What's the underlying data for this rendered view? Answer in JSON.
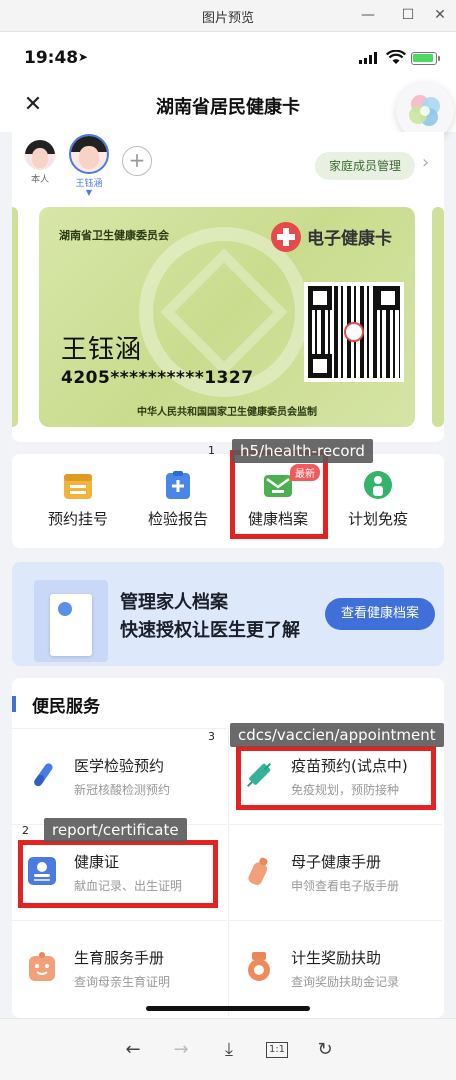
{
  "window": {
    "title": "图片预览",
    "min_label": "—",
    "max_label": "☐",
    "close_label": "✕"
  },
  "status": {
    "time": "19:48"
  },
  "nav": {
    "title": "湖南省居民健康卡"
  },
  "members": [
    {
      "name": "本人"
    },
    {
      "name": "王钰涵"
    }
  ],
  "add_member": "+",
  "family_button": "家庭成员管理",
  "card": {
    "org": "湖南省卫生健康委员会",
    "title": "电子健康卡",
    "holder": "王钰涵",
    "id_number": "4205**********1327",
    "supervisor": "中华人民共和国国家卫生健康委员会监制"
  },
  "quick_actions": [
    {
      "label": "预约挂号",
      "icon": "calendar-icon",
      "color": "#f3b23a"
    },
    {
      "label": "检验报告",
      "icon": "clipboard-plus-icon",
      "color": "#4a86e8"
    },
    {
      "label": "健康档案",
      "icon": "health-record-icon",
      "color": "#4caf50",
      "badge": "最新"
    },
    {
      "label": "计划免疫",
      "icon": "vaccine-person-icon",
      "color": "#34b36a"
    }
  ],
  "banner": {
    "line1": "管理家人档案",
    "line2": "快速授权让医生更了解",
    "button": "查看健康档案"
  },
  "services": {
    "title": "便民服务",
    "items": [
      {
        "title": "医学检验预约",
        "subtitle": "新冠核酸检测预约",
        "icon": "test-tube-icon",
        "color": "#4a7be0"
      },
      {
        "title": "疫苗预约(试点中)",
        "subtitle": "免疫规划，预防接种",
        "icon": "syringe-icon",
        "color": "#34b39a"
      },
      {
        "title": "健康证",
        "subtitle": "献血记录、出生证明",
        "icon": "id-card-icon",
        "color": "#4a7be0"
      },
      {
        "title": "母子健康手册",
        "subtitle": "申领查看电子版手册",
        "icon": "baby-bottle-icon",
        "color": "#f2a07a"
      },
      {
        "title": "生育服务手册",
        "subtitle": "查询母亲生育证明",
        "icon": "baby-face-icon",
        "color": "#f2a07a"
      },
      {
        "title": "计生奖励扶助",
        "subtitle": "查询奖励扶助金记录",
        "icon": "medal-icon",
        "color": "#f08a5a"
      }
    ]
  },
  "bottom_toolbar": [
    "back-icon",
    "forward-icon",
    "download-icon",
    "actual-size-icon",
    "refresh-icon"
  ],
  "actual_size_label": "1:1",
  "overlays": [
    {
      "num": "1",
      "tag": "h5/health-record"
    },
    {
      "num": "2",
      "tag": "report/certificate"
    },
    {
      "num": "3",
      "tag": "cdcs/vaccien/appointment"
    }
  ]
}
